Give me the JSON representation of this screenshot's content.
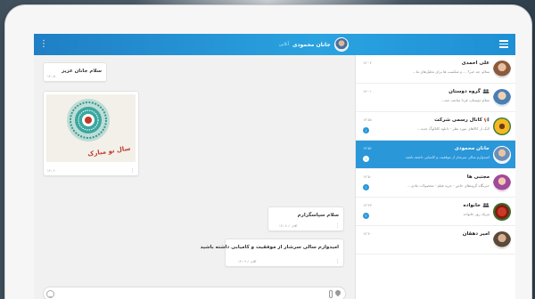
{
  "header": {
    "contact_name": "جانان محمودی",
    "contact_status": "آنلاین"
  },
  "chat": {
    "messages": [
      {
        "text": "سلام جانان عزیز",
        "time": "۱۴:۰۵"
      },
      {
        "type": "image",
        "caption_art": "سال نو مبارک",
        "time": "۱۴:۰۶"
      },
      {
        "text": "سلام سپاسگزارم",
        "time": "۱۴:۰۸ ✓ آقای"
      },
      {
        "text": "امیدوارم سالی سرشار از موفقیت و کامیابی داشته باشید",
        "time": "۱۴:۰۹ ✓ آقای"
      }
    ],
    "composer_placeholder": ""
  },
  "sidebar": {
    "items": [
      {
        "name": "علی احمدی",
        "preview": "سلام، چه خبر؟ ... و شکست ها برای تحلیل‌های ما...",
        "time": "۱۴:۰۴",
        "badge": "",
        "avatar_color": "#8b5a3c"
      },
      {
        "name": "گروه دوستان",
        "preview": "سلام دوستان، فردا ساعت چند...",
        "time": "۱۴:۰۱",
        "badge": "",
        "avatar_color": "#4a7fb5",
        "group": true
      },
      {
        "name": "کانال رسمی شرکت",
        "preview": "لایک از کالاهای مورد نظر - دانلود کاتالوگ جدید...",
        "time": "۱۳:۵۸",
        "badge": "۱",
        "avatar_color": "#f0b030",
        "channel": true
      },
      {
        "name": "جانان محمودی",
        "preview": "امیدوارم سالی سرشار از موفقیت و کامیابی داشته باشید",
        "time": "۱۳:۵۶",
        "badge": "۱",
        "avatar_color": "#6a8fb8",
        "active": true
      },
      {
        "name": "مجتبی ها",
        "preview": "خبرنگاه گروه‌های خاص - خرید فیلم - محصولات مادی...",
        "time": "۱۳:۵۰",
        "badge": "۱",
        "avatar_color": "#a04a9a"
      },
      {
        "name": "خانواده",
        "preview": "تبریک روز خانواده",
        "time": "۱۳:۴۷",
        "badge": "۲",
        "avatar_color": "#c83a2a",
        "group": true
      },
      {
        "name": "امیر دهقان",
        "preview": "",
        "time": "۱۳:۴۰",
        "badge": "",
        "avatar_color": "#5a4a3a"
      }
    ]
  }
}
